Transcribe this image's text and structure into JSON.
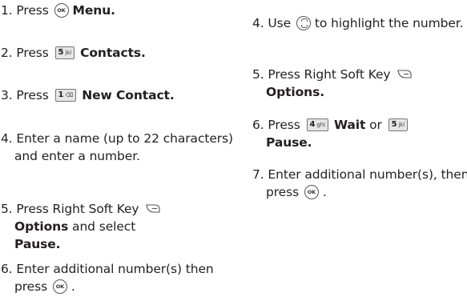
{
  "icons": {
    "ok": "ok-key-icon",
    "nav": "navigation-key-icon",
    "soft": "right-soft-key-icon"
  },
  "left": {
    "s1": {
      "num": "1.",
      "press": "Press",
      "key_label": "OK",
      "text": "Menu."
    },
    "s2": {
      "num": "2.",
      "press": "Press",
      "key_num": "5",
      "key_letters": "jkl",
      "text": "Contacts."
    },
    "s3": {
      "num": "3.",
      "press": "Press",
      "key_num": "1",
      "key_letters": "voicemail",
      "text": "New Contact."
    },
    "s4": {
      "num": "4.",
      "text": "Enter a name (up to 22 characters) and enter a number."
    },
    "s5": {
      "num": "5.",
      "text": "Press Right Soft Key",
      "opt": "Options",
      "mid": "and select",
      "pause": "Pause."
    },
    "s6": {
      "num": "6.",
      "text": "Enter additional number(s) then press",
      "end": "."
    }
  },
  "right": {
    "s4": {
      "num": "4.",
      "use": "Use",
      "text": "to highlight the number."
    },
    "s5": {
      "num": "5.",
      "text": "Press Right Soft Key",
      "opt": "Options."
    },
    "s6": {
      "num": "6.",
      "press": "Press",
      "key1_num": "4",
      "key1_letters": "ghi",
      "wait": "Wait",
      "or": "or",
      "key2_num": "5",
      "key2_letters": "jkl",
      "pause": "Pause."
    },
    "s7": {
      "num": "7.",
      "text": "Enter additional number(s), then press",
      "end": "."
    }
  }
}
